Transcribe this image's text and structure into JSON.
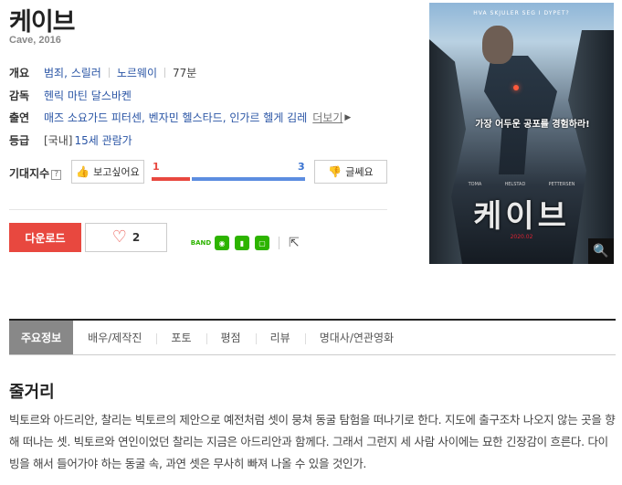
{
  "movie": {
    "title": "케이브",
    "subtitle": "Cave, 2016"
  },
  "info": {
    "overview_label": "개요",
    "genre": "범죄, 스릴러",
    "country": "노르웨이",
    "runtime": "77분",
    "director_label": "감독",
    "director": "헨릭 마틴 달스바켄",
    "cast_label": "출연",
    "cast": "매즈 소요가드 피터센, 벤자민 헬스타드, 인가르 헬게 김레",
    "more_label": "더보기",
    "rating_label": "등급",
    "rating_region": "[국내]",
    "rating": "15세 관람가"
  },
  "expectation": {
    "label": "기대지수",
    "help": "?",
    "want_label": "보고싶어요",
    "want_count": "1",
    "no_label": "글쎄요",
    "no_count": "3"
  },
  "actions": {
    "download_label": "다운로드",
    "like_count": "2",
    "share_icons": [
      "band-icon",
      "kakaostory-icon",
      "naver-bookmark-icon",
      "line-icon",
      "share-icon"
    ]
  },
  "poster": {
    "top_text": "HVA SKJULER SEG I DYPET?",
    "tagline": "가장 어두운 공포를 경험하라!",
    "names": [
      "TOMA",
      "HELSTAD",
      "PETTERSEN"
    ],
    "title": "케이브",
    "date": "2020.02"
  },
  "tabs": [
    {
      "label": "주요정보",
      "active": true
    },
    {
      "label": "배우/제작진",
      "active": false
    },
    {
      "label": "포토",
      "active": false
    },
    {
      "label": "평점",
      "active": false
    },
    {
      "label": "리뷰",
      "active": false
    },
    {
      "label": "명대사/연관영화",
      "active": false
    }
  ],
  "synopsis": {
    "title": "줄거리",
    "text": "빅토르와 아드리안, 찰리는 빅토르의 제안으로 예전처럼 셋이 뭉쳐 동굴 탐험을 떠나기로 한다. 지도에 출구조차 나오지 않는 곳을 향해 떠나는 셋. 빅토르와 연인이었던 찰리는 지금은 아드리안과 함께다. 그래서 그런지 세 사람 사이에는 묘한 긴장감이 흐른다. 다이빙을 해서 들어가야 하는 동굴 속, 과연 셋은 무사히 빠져 나올 수 있을 것인가."
  },
  "colors": {
    "accent_red": "#e8483f",
    "accent_blue": "#3a73d1",
    "link": "#2a55a5"
  }
}
